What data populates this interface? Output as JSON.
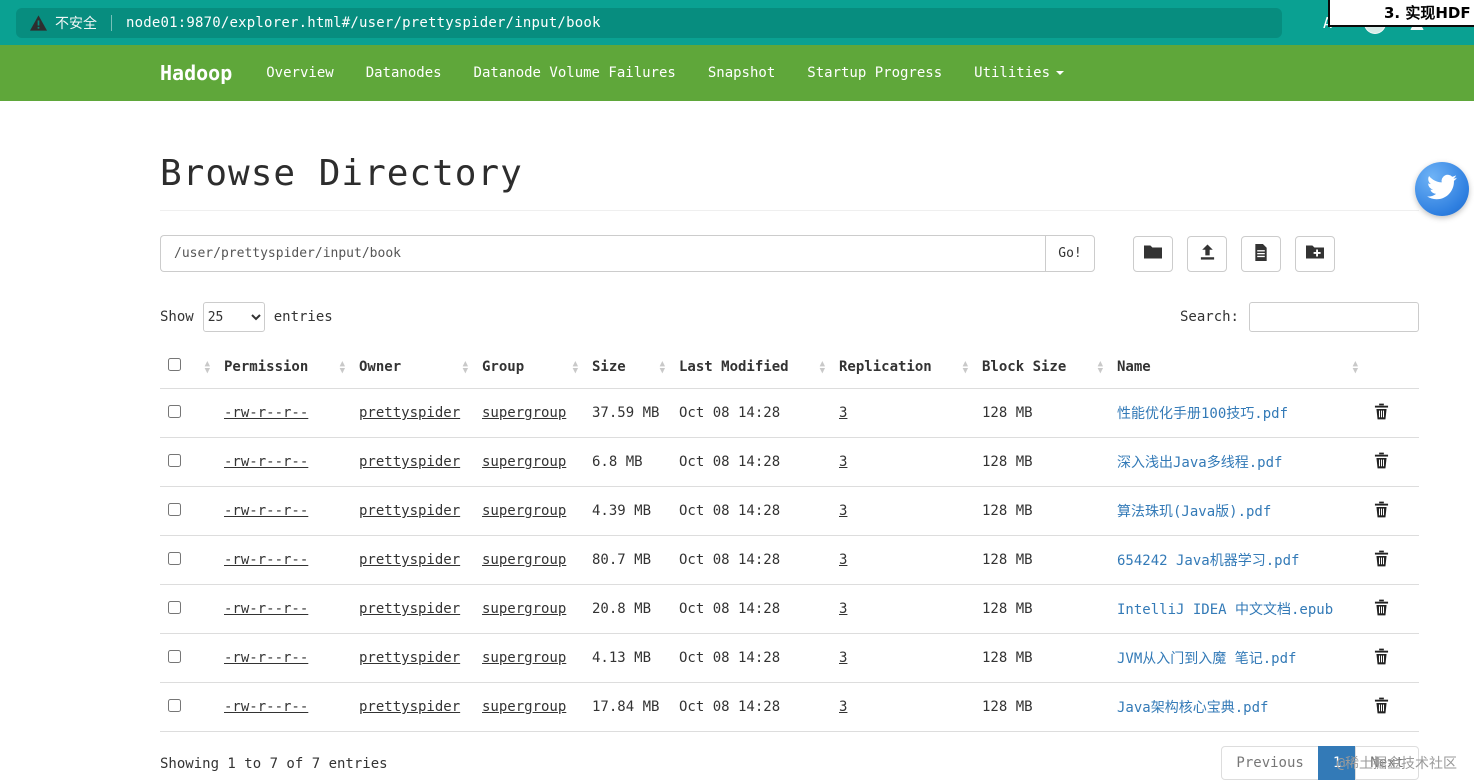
{
  "browser": {
    "security_label": "不安全",
    "url": "node01:9870/explorer.html#/user/prettyspider/input/book",
    "read_aloud_label": "A",
    "overlay_note": "3. 实现HDF"
  },
  "navbar": {
    "brand": "Hadoop",
    "items": [
      {
        "label": "Overview"
      },
      {
        "label": "Datanodes"
      },
      {
        "label": "Datanode Volume Failures"
      },
      {
        "label": "Snapshot"
      },
      {
        "label": "Startup Progress"
      },
      {
        "label": "Utilities"
      }
    ]
  },
  "page": {
    "title": "Browse Directory",
    "path_value": "/user/prettyspider/input/book",
    "go_label": "Go!",
    "show_label": "Show",
    "entries_label": "entries",
    "page_size": "25",
    "search_label": "Search:"
  },
  "toolbar": {
    "icons": [
      "folder-icon",
      "upload-icon",
      "file-icon",
      "create-directory-icon"
    ]
  },
  "table": {
    "headers": [
      "Permission",
      "Owner",
      "Group",
      "Size",
      "Last Modified",
      "Replication",
      "Block Size",
      "Name"
    ],
    "rows": [
      {
        "permission": "-rw-r--r--",
        "owner": "prettyspider",
        "group": "supergroup",
        "size": "37.59 MB",
        "modified": "Oct 08 14:28",
        "replication": "3",
        "block_size": "128 MB",
        "name": "性能优化手册100技巧.pdf"
      },
      {
        "permission": "-rw-r--r--",
        "owner": "prettyspider",
        "group": "supergroup",
        "size": "6.8 MB",
        "modified": "Oct 08 14:28",
        "replication": "3",
        "block_size": "128 MB",
        "name": "深入浅出Java多线程.pdf"
      },
      {
        "permission": "-rw-r--r--",
        "owner": "prettyspider",
        "group": "supergroup",
        "size": "4.39 MB",
        "modified": "Oct 08 14:28",
        "replication": "3",
        "block_size": "128 MB",
        "name": "算法珠玑(Java版).pdf"
      },
      {
        "permission": "-rw-r--r--",
        "owner": "prettyspider",
        "group": "supergroup",
        "size": "80.7 MB",
        "modified": "Oct 08 14:28",
        "replication": "3",
        "block_size": "128 MB",
        "name": "654242 Java机器学习.pdf"
      },
      {
        "permission": "-rw-r--r--",
        "owner": "prettyspider",
        "group": "supergroup",
        "size": "20.8 MB",
        "modified": "Oct 08 14:28",
        "replication": "3",
        "block_size": "128 MB",
        "name": "IntelliJ IDEA 中文文档.epub"
      },
      {
        "permission": "-rw-r--r--",
        "owner": "prettyspider",
        "group": "supergroup",
        "size": "4.13 MB",
        "modified": "Oct 08 14:28",
        "replication": "3",
        "block_size": "128 MB",
        "name": "JVM从入门到入魔 笔记.pdf"
      },
      {
        "permission": "-rw-r--r--",
        "owner": "prettyspider",
        "group": "supergroup",
        "size": "17.84 MB",
        "modified": "Oct 08 14:28",
        "replication": "3",
        "block_size": "128 MB",
        "name": "Java架构核心宝典.pdf"
      }
    ]
  },
  "pagination": {
    "previous": "Previous",
    "current": "1",
    "next": "Next"
  },
  "footer": {
    "summary": "Showing 1 to 7 of 7 entries",
    "watermark": "@稀土掘金技术社区"
  },
  "colors": {
    "chrome_teal": "#0aa192",
    "url_pill_teal": "#078d7f",
    "navbar_green": "#5fa73a",
    "link_blue": "#337ab7",
    "active_page_blue": "#337ab7"
  }
}
